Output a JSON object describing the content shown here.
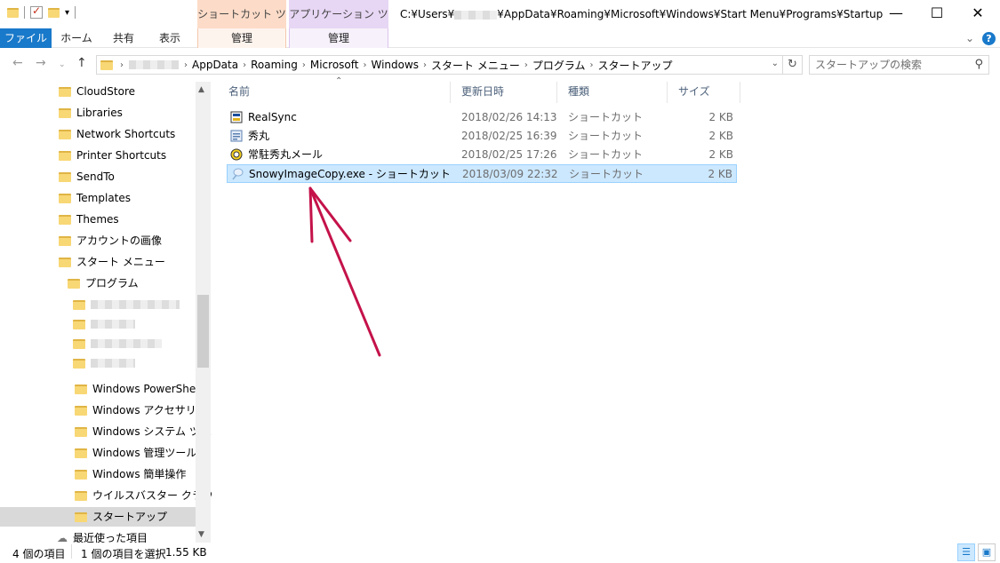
{
  "titlebar": {
    "context_tab_shortcut": "ショートカット ツール",
    "context_tab_app": "アプリケーション ツール",
    "path_prefix": "C:¥Users¥",
    "path_suffix": "¥AppData¥Roaming¥Microsoft¥Windows¥Start Menu¥Programs¥Startup",
    "minimize": "—",
    "maximize": "☐",
    "close": "✕"
  },
  "ribbon": {
    "file": "ファイル",
    "home": "ホーム",
    "share": "共有",
    "view": "表示",
    "manage_shortcut": "管理",
    "manage_app": "管理",
    "help": "?"
  },
  "address": {
    "crumbs": [
      "AppData",
      "Roaming",
      "Microsoft",
      "Windows",
      "スタート メニュー",
      "プログラム",
      "スタートアップ"
    ],
    "search_placeholder": "スタートアップの検索"
  },
  "nav_tree": {
    "items": [
      "CloudStore",
      "Libraries",
      "Network Shortcuts",
      "Printer Shortcuts",
      "SendTo",
      "Templates",
      "Themes",
      "アカウントの画像",
      "スタート メニュー",
      "プログラム",
      "Windows PowerShell",
      "Windows アクセサリ",
      "Windows システム ツール",
      "Windows 管理ツール",
      "Windows 簡単操作",
      "ウイルスバスター クラウド",
      "スタートアップ",
      "最近使った項目"
    ]
  },
  "columns": {
    "name": "名前",
    "date": "更新日時",
    "type": "種類",
    "size": "サイズ"
  },
  "files": [
    {
      "name": "RealSync",
      "date": "2018/02/26 14:13",
      "type": "ショートカット",
      "size": "2 KB"
    },
    {
      "name": "秀丸",
      "date": "2018/02/25 16:39",
      "type": "ショートカット",
      "size": "2 KB"
    },
    {
      "name": "常駐秀丸メール",
      "date": "2018/02/25 17:26",
      "type": "ショートカット",
      "size": "2 KB"
    },
    {
      "name": "SnowyImageCopy.exe - ショートカット",
      "date": "2018/03/09 22:32",
      "type": "ショートカット",
      "size": "2 KB"
    }
  ],
  "status": {
    "count": "4 個の項目",
    "selected": "1 個の項目を選択",
    "size": "1.55 KB"
  },
  "annotation_color": "#c4124a"
}
